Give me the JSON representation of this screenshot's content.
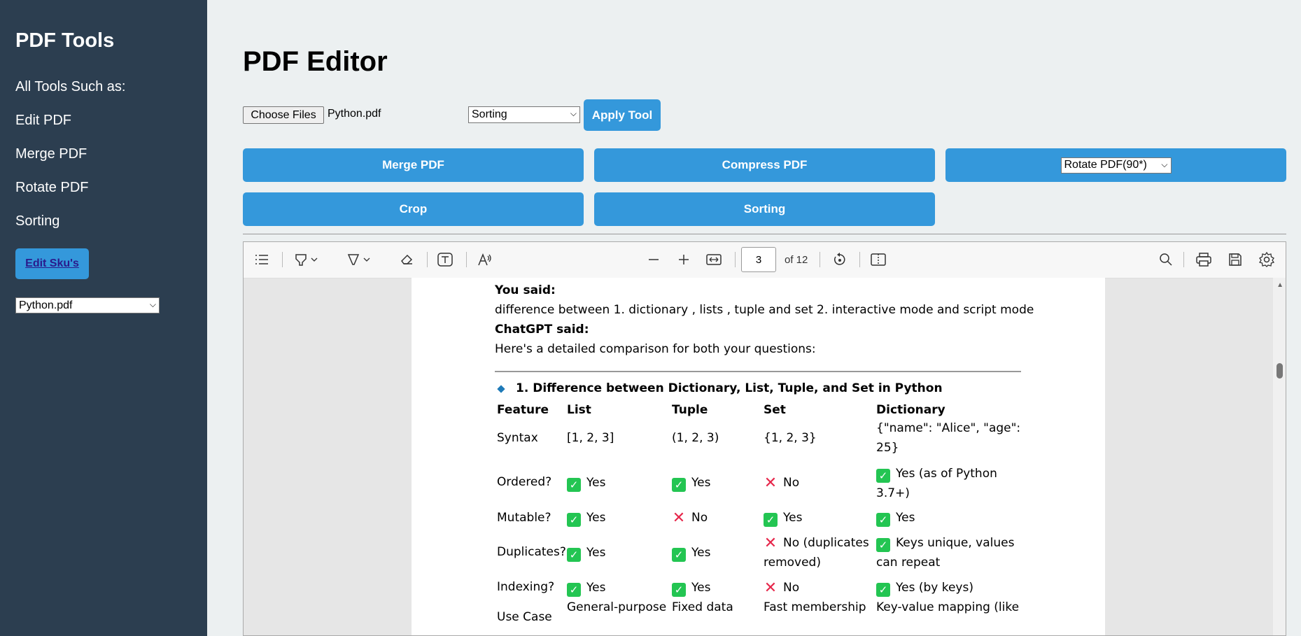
{
  "sidebar": {
    "title": "PDF Tools",
    "subtitle": "All Tools Such as:",
    "links": [
      "Edit PDF",
      "Merge PDF",
      "Rotate PDF",
      "Sorting"
    ],
    "sku_button": "Edit Sku's",
    "file_select": "Python.pdf"
  },
  "main": {
    "title": "PDF Editor",
    "choose_files": "Choose Files",
    "file_name": "Python.pdf",
    "tool_select": "Sorting",
    "apply": "Apply Tool",
    "buttons": {
      "merge": "Merge PDF",
      "compress": "Compress PDF",
      "rotate_select": "Rotate PDF(90*)",
      "crop": "Crop",
      "sorting": "Sorting"
    }
  },
  "viewer": {
    "page_number": "3",
    "page_total": "of 12",
    "icons": [
      "outline-icon",
      "highlight-icon",
      "draw-icon",
      "erase-icon",
      "text-box-icon",
      "read-aloud-icon",
      "zoom-out-icon",
      "zoom-in-icon",
      "fit-width-icon",
      "rotate-icon",
      "page-view-icon",
      "search-icon",
      "print-icon",
      "save-icon",
      "settings-icon"
    ]
  },
  "document": {
    "you_said": "You said:",
    "question": "difference between 1. dictionary , lists , tuple and set 2. interactive mode and script mode",
    "chatgpt_said": "ChatGPT said:",
    "intro": "Here's a detailed comparison for both your questions:",
    "section_heading": "1. Difference between Dictionary, List, Tuple, and Set in Python",
    "table_headers": [
      "Feature",
      "List",
      "Tuple",
      "Set",
      "Dictionary"
    ],
    "syntax": {
      "label": "Syntax",
      "list": "[1, 2, 3]",
      "tuple": "(1, 2, 3)",
      "set": "{1, 2, 3}",
      "dict_1": "{\"name\": \"Alice\", \"age\":",
      "dict_2": "25}"
    },
    "ordered": {
      "label": "Ordered?",
      "list": "Yes",
      "tuple": "Yes",
      "set": "No",
      "dict_1": "Yes (as of Python",
      "dict_2": "3.7+)"
    },
    "mutable": {
      "label": "Mutable?",
      "list": "Yes",
      "tuple": "No",
      "set": "Yes",
      "dict": "Yes"
    },
    "duplicates": {
      "label": "Duplicates?",
      "list": "Yes",
      "tuple": "Yes",
      "set_1": "No (duplicates",
      "set_2": "removed)",
      "dict_1": "Keys unique, values",
      "dict_2": "can repeat"
    },
    "indexing": {
      "label": "Indexing?",
      "list": "Yes",
      "tuple": "Yes",
      "set": "No",
      "dict": "Yes (by keys)"
    },
    "usecase": {
      "label": "Use Case",
      "list": "General-purpose",
      "tuple": "Fixed data",
      "set": "Fast membership",
      "dict": "Key-value mapping (like"
    }
  }
}
